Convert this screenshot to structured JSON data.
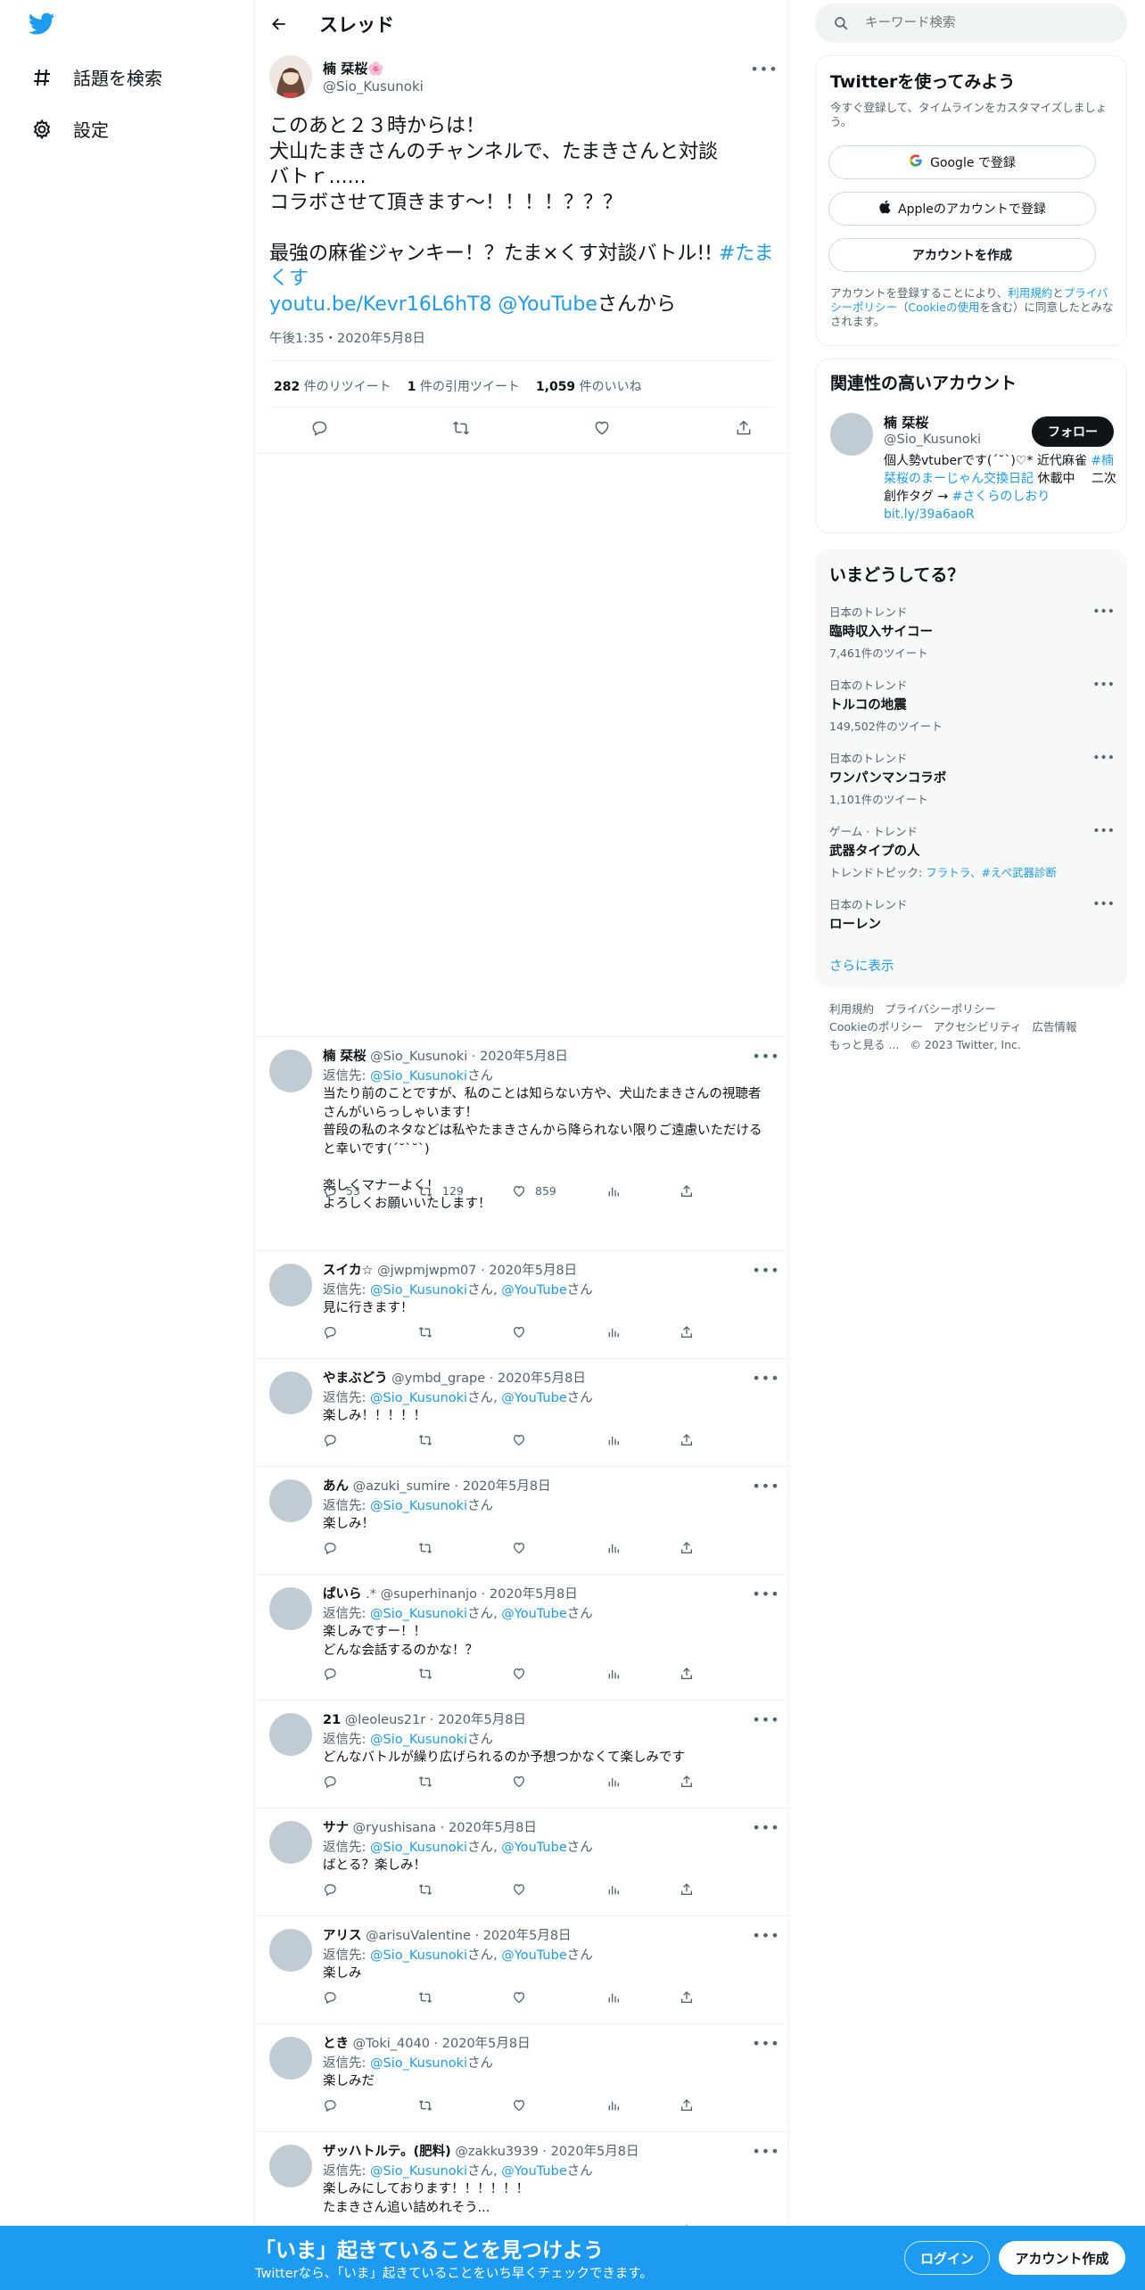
{
  "nav": {
    "items": [
      {
        "label": "話題を検索",
        "icon": "hashtag-icon"
      },
      {
        "label": "設定",
        "icon": "gear-icon"
      }
    ]
  },
  "header": {
    "title": "スレッド"
  },
  "tweet": {
    "author_name": "楠 栞桜🌸",
    "author_handle": "@Sio_Kusunoki",
    "lines": [
      "このあと２３時からは！",
      "犬山たまきさんのチャンネルで、たまきさんと対談",
      "バトｒ......",
      "コラボさせて頂きます～！！！！？？？",
      "",
      "最強の麻雀ジャンキー！？たま×くす対談バトル!!"
    ],
    "hashtag": "#たまくす",
    "link": "youtu.be/Kevr16L6hT8",
    "mention": "@YouTube",
    "suffix": "さんから",
    "time": "午後1:35・2020年5月8日",
    "retweets": "282",
    "retweets_label": "件のリツイート",
    "quotes": "1",
    "quotes_label": "件の引用ツイート",
    "likes": "1,059",
    "likes_label": "件のいいね"
  },
  "replies": [
    {
      "name": "楠 栞桜",
      "handle": "@Sio_Kusunoki",
      "date": "2020年5月8日",
      "to_prefix": "返信先: ",
      "to": [
        "@Sio_Kusunoki"
      ],
      "to_suffix": "さん",
      "text": "当たり前のことですが、私のことは知らない方や、犬山たまきさんの視聴者さんがいらっしゃいます！\n普段の私のネタなどは私やたまきさんから降られない限りご遠慮いただけると幸いです(´˘`˘`)\n\n楽しくマナーよく！\nよろしくお願いいたします！",
      "replies": "53",
      "rts": "129",
      "likes": "859"
    },
    {
      "name": "スイカ☆",
      "handle": "@jwpmjwpm07",
      "date": "2020年5月8日",
      "to_prefix": "返信先: ",
      "to": [
        "@Sio_Kusunoki",
        "@YouTube"
      ],
      "to_suffix": "さん",
      "text": "見に行きます！"
    },
    {
      "name": "やまぶどう",
      "handle": "@ymbd_grape",
      "date": "2020年5月8日",
      "to_prefix": "返信先: ",
      "to": [
        "@Sio_Kusunoki",
        "@YouTube"
      ],
      "to_suffix": "さん",
      "text": "楽しみ！！！！！"
    },
    {
      "name": "あん",
      "handle": "@azuki_sumire",
      "date": "2020年5月8日",
      "to_prefix": "返信先: ",
      "to": [
        "@Sio_Kusunoki"
      ],
      "to_suffix": "さん",
      "text": "楽しみ！"
    },
    {
      "name": "ぱいら",
      "handle": ".* @superhinanjo",
      "date": "2020年5月8日",
      "to_prefix": "返信先: ",
      "to": [
        "@Sio_Kusunoki",
        "@YouTube"
      ],
      "to_suffix": "さん",
      "text": "楽しみですー！！\nどんな会話するのかな！？"
    },
    {
      "name": "21",
      "handle": "@leoleus21r",
      "date": "2020年5月8日",
      "to_prefix": "返信先: ",
      "to": [
        "@Sio_Kusunoki"
      ],
      "to_suffix": "さん",
      "text": "どんなバトルが繰り広げられるのか予想つかなくて楽しみです"
    },
    {
      "name": "サナ",
      "handle": "@ryushisana",
      "date": "2020年5月8日",
      "to_prefix": "返信先: ",
      "to": [
        "@Sio_Kusunoki",
        "@YouTube"
      ],
      "to_suffix": "さん",
      "text": "ばとる？楽しみ！"
    },
    {
      "name": "アリス",
      "handle": "@arisuValentine",
      "date": "2020年5月8日",
      "to_prefix": "返信先: ",
      "to": [
        "@Sio_Kusunoki",
        "@YouTube"
      ],
      "to_suffix": "さん",
      "text": "楽しみ"
    },
    {
      "name": "とき",
      "handle": "@Toki_4040",
      "date": "2020年5月8日",
      "to_prefix": "返信先: ",
      "to": [
        "@Sio_Kusunoki"
      ],
      "to_suffix": "さん",
      "text": "楽しみだ"
    },
    {
      "name": "ザッハトルテ。(肥料)",
      "handle": "@zakku3939",
      "date": "2020年5月8日",
      "to_prefix": "返信先: ",
      "to": [
        "@Sio_Kusunoki",
        "@YouTube"
      ],
      "to_suffix": "さん",
      "text": "楽しみにしております！！！！！！\nたまきさん追い詰めれそう..."
    }
  ],
  "search": {
    "placeholder": "キーワード検索"
  },
  "signup_panel": {
    "title": "Twitterを使ってみよう",
    "desc": "今すぐ登録して、タイムラインをカスタマイズしましょう。",
    "google": "Google で登録",
    "apple": "Appleのアカウントで登録",
    "create": "アカウントを作成",
    "terms_pre": "アカウントを登録することにより、",
    "terms_link1": "利用規約",
    "terms_mid": "と",
    "terms_link2": "プライバシーポリシー",
    "terms_paren_open": "（",
    "terms_link3": "Cookieの使用",
    "terms_post": "を含む）に同意したとみなされます。"
  },
  "related_panel": {
    "title": "関連性の高いアカウント",
    "name": "楠 栞桜",
    "handle": "@Sio_Kusunoki",
    "follow": "フォロー",
    "bio_1": "個人勢vtuberです(´˘`)♡* 近代麻雀 ",
    "bio_tag1": "#楠栞桜のまーじゃん交換日記",
    "bio_2": " 休載中　 二次創作タグ → ",
    "bio_tag2": "#さくらのしおり",
    "bio_3": " ",
    "bio_link": "bit.ly/39a6aoR"
  },
  "trends_panel": {
    "title": "いまどうしてる？",
    "items": [
      {
        "category": "日本のトレンド",
        "name": "臨時収入サイコー",
        "count": "7,461件のツイート"
      },
      {
        "category": "日本のトレンド",
        "name": "トルコの地震",
        "count": "149,502件のツイート"
      },
      {
        "category": "日本のトレンド",
        "name": "ワンパンマンコラボ",
        "count": "1,101件のツイート"
      },
      {
        "category": "ゲーム · トレンド",
        "name": "武器タイプの人",
        "count_prefix": "トレンドトピック: ",
        "topics": "フラトラ、#えぺ武器診断"
      },
      {
        "category": "日本のトレンド",
        "name": "ローレン"
      }
    ],
    "show_more": "さらに表示"
  },
  "footer": {
    "links": [
      "利用規約",
      "プライバシーポリシー",
      "Cookieのポリシー",
      "アクセシビリティ",
      "広告情報",
      "もっと見る ..."
    ],
    "copyright": "© 2023 Twitter, Inc."
  },
  "bottom_bar": {
    "title": "「いま」起きていることを見つけよう",
    "subtitle": "Twitterなら、「いま」起きていることをいち早くチェックできます。",
    "login": "ログイン",
    "signup": "アカウント作成"
  },
  "colors": {
    "accent": "#1d9bf0",
    "text": "#0f1419",
    "secondary": "#536471"
  }
}
